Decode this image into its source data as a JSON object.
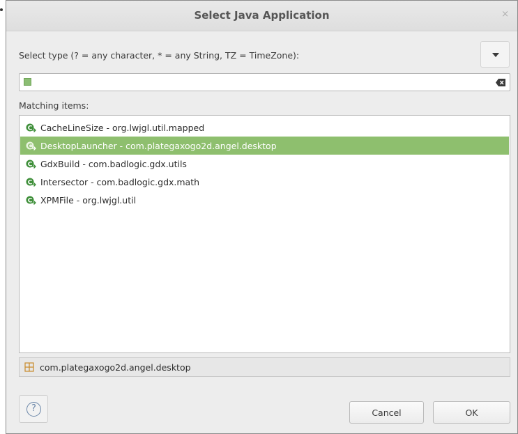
{
  "window": {
    "title": "Select Java Application",
    "close_symbol": "×"
  },
  "filter": {
    "prompt": "Select type (? = any character, * = any String, TZ = TimeZone):",
    "value": "",
    "dropdown_icon": "triangle-down-icon",
    "clear_icon": "clear-text-icon"
  },
  "matching": {
    "label": "Matching items:",
    "items": [
      {
        "label": "CacheLineSize - org.lwjgl.util.mapped",
        "icon": "java-class-main-icon",
        "selected": false
      },
      {
        "label": "DesktopLauncher - com.plategaxogo2d.angel.desktop",
        "icon": "java-class-main-icon",
        "selected": true
      },
      {
        "label": "GdxBuild - com.badlogic.gdx.utils",
        "icon": "java-class-main-icon",
        "selected": false
      },
      {
        "label": "Intersector - com.badlogic.gdx.math",
        "icon": "java-class-main-icon",
        "selected": false
      },
      {
        "label": "XPMFile - org.lwjgl.util",
        "icon": "java-class-main-icon",
        "selected": false
      }
    ]
  },
  "status": {
    "package": "com.plategaxogo2d.angel.desktop",
    "icon": "package-icon"
  },
  "buttons": {
    "help_symbol": "?",
    "cancel": "Cancel",
    "ok": "OK"
  },
  "colors": {
    "selection": "#8ebf6e",
    "class_icon": "#3f8f3a",
    "package_icon": "#c98a2a",
    "help_icon": "#6a86a8"
  }
}
